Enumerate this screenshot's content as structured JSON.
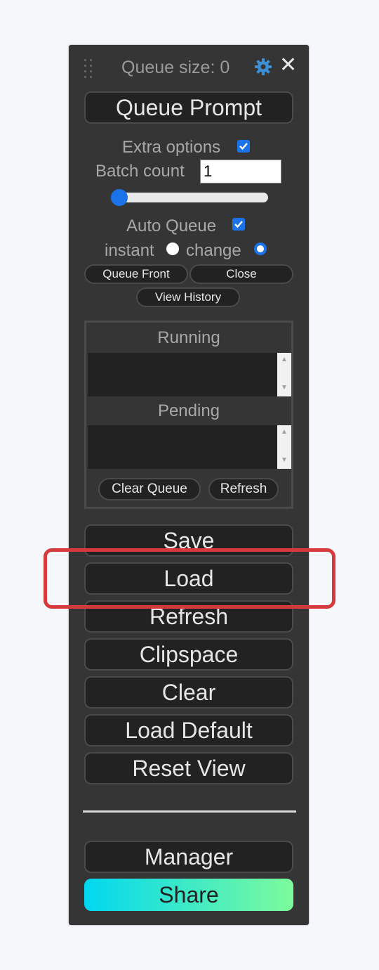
{
  "panel": {
    "queue_size_label": "Queue size: 0",
    "icons": {
      "drag": "drag-handle-icon",
      "settings": "gear-icon",
      "close": "close-icon"
    },
    "close_glyph": "✕"
  },
  "queue_prompt_label": "Queue Prompt",
  "extra_options": {
    "label": "Extra options",
    "checked": true
  },
  "batch_count": {
    "label": "Batch count",
    "value": "1"
  },
  "slider": {
    "value": 0
  },
  "auto_queue": {
    "label": "Auto Queue",
    "checked": true
  },
  "mode": {
    "instant_label": "instant",
    "change_label": "change",
    "selected": "change"
  },
  "small_buttons": {
    "queue_front": "Queue Front",
    "close": "Close",
    "view_history": "View History"
  },
  "queue": {
    "running_label": "Running",
    "pending_label": "Pending",
    "clear_queue": "Clear Queue",
    "refresh": "Refresh"
  },
  "menu": {
    "save": "Save",
    "load": "Load",
    "refresh": "Refresh",
    "clipspace": "Clipspace",
    "clear": "Clear",
    "load_default": "Load Default",
    "reset_view": "Reset View",
    "manager": "Manager",
    "share": "Share"
  },
  "colors": {
    "panel_bg": "#353535",
    "button_bg": "#222222",
    "accent": "#1a73e8",
    "highlight": "#d73a3a",
    "share_gradient": [
      "#00d8f0",
      "#7dfb9c"
    ]
  }
}
